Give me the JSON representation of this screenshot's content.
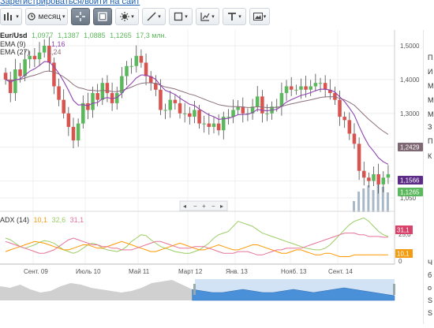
{
  "top_link": "Зарегистрироваться/войти на сайт",
  "toolbar": {
    "period_label": "месяц",
    "tools": [
      "bar-chart-icon",
      "clock-icon",
      "crosshair-icon",
      "candles-icon",
      "indicators-icon",
      "draw-line-icon",
      "shapes-icon",
      "fibonacci-icon",
      "text-icon",
      "image-icon"
    ]
  },
  "legend": {
    "symbol": "Eur/Usd",
    "open": "1,0977",
    "high": "1,1387",
    "low": "1,0885",
    "close": "1,1265",
    "volume": "17,3 млн.",
    "ema9_label": "EMA (9)",
    "ema9_value": "1,16",
    "ema27_label": "EMA (27)",
    "ema27_value": "1,24",
    "adx_label": "ADX (14)",
    "adx_v1": "10,1",
    "adx_v2": "32,6",
    "adx_v3": "31,1"
  },
  "price_boxes": {
    "ema27": "1,2429",
    "ema9": "1,1566",
    "last": "1,1265"
  },
  "adx_boxes": {
    "a": "31,1",
    "b": "10,1"
  },
  "colors": {
    "up": "#5cb85c",
    "down": "#d9534f",
    "ema9": "#8e44ad",
    "ema27": "#8b6f7a",
    "volume": "#a9b8c8",
    "adx": "#9ccc65",
    "dip": "#ff9800",
    "dim": "#e57399",
    "ema27_box": "#7e6873",
    "ema9_box": "#5b2b86",
    "last_box": "#5cb85c"
  },
  "chart_data": {
    "type": "candlestick",
    "title": "Eur/Usd",
    "y_ticks": [
      "1,5000",
      "1,4000",
      "1,3000",
      "1,2000",
      "1,1000",
      "1,050"
    ],
    "x_ticks": [
      "Сент. 09",
      "Июль 10",
      "Май 11",
      "Март 12",
      "Янв. 13",
      "Нояб. 13",
      "Сент. 14"
    ],
    "adx_ticks": [
      "25,0",
      "0"
    ],
    "ylim": [
      1.02,
      1.52
    ]
  },
  "sidebar": {
    "lines": [
      "П",
      "И",
      "М",
      "М",
      "М",
      "З",
      "П",
      "К",
      "Ч",
      "б",
      "о",
      "S",
      "S"
    ]
  }
}
